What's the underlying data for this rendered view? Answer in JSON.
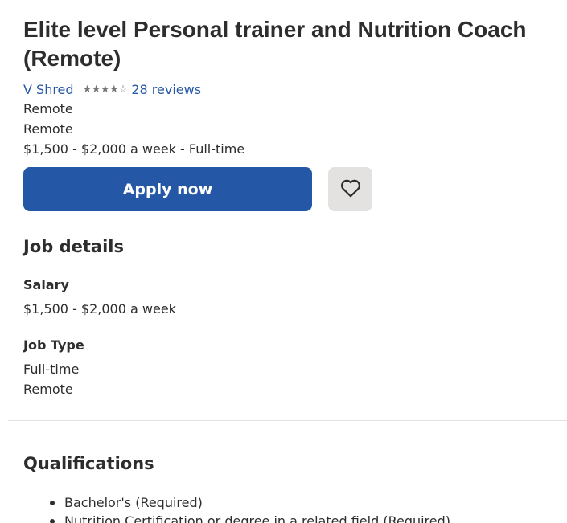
{
  "job": {
    "title_line1": "Elite level Personal trainer and Nutrition Coach",
    "title_line2": "(Remote)",
    "company": "V Shred",
    "rating": 4,
    "rating_max": 5,
    "reviews": "28 reviews",
    "location1": "Remote",
    "location2": "Remote",
    "salary_summary": "$1,500 - $2,000 a week",
    "type_summary": " - Full-time"
  },
  "actions": {
    "apply_label": "Apply now",
    "save_icon": "heart-icon"
  },
  "details": {
    "heading": "Job details",
    "salary_label": "Salary",
    "salary_value": "$1,500 - $2,000 a week",
    "type_label": "Job Type",
    "type_values": [
      "Full-time",
      "Remote"
    ]
  },
  "qualifications": {
    "heading": "Qualifications",
    "items": [
      "Bachelor's (Required)",
      "Nutrition Certification or degree in a related field (Required)"
    ]
  },
  "colors": {
    "link": "#2557a7",
    "apply_bg": "#2557a7",
    "save_bg": "#e4e2e0",
    "text": "#2d2d2d"
  }
}
